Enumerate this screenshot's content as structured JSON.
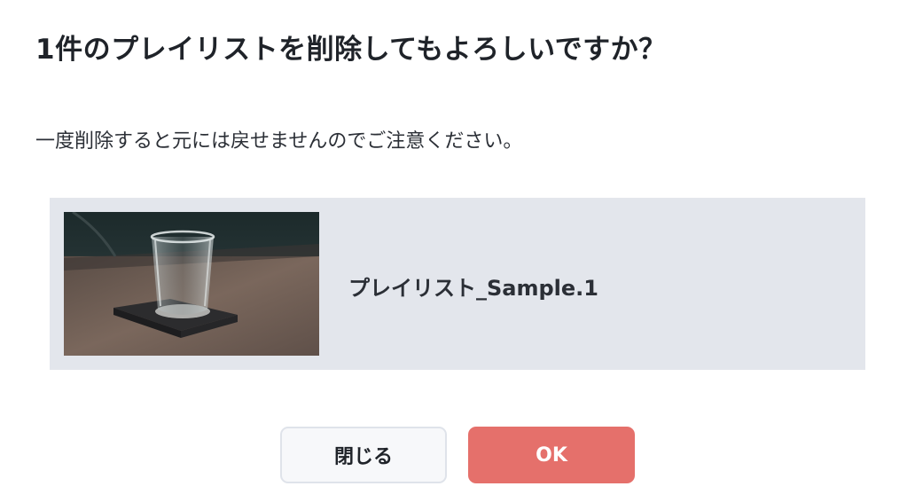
{
  "dialog": {
    "title": "1件のプレイリストを削除してもよろしいですか？",
    "message": "一度削除すると元には戻せませんのでご注意ください。"
  },
  "playlist": {
    "name": "プレイリスト_Sample.1",
    "thumbnail": "glass-on-coaster-photo"
  },
  "buttons": {
    "close_label": "閉じる",
    "ok_label": "OK"
  },
  "colors": {
    "ok_button": "#e5706b",
    "card_background": "#e3e6ec",
    "close_button": "#f7f8fa"
  }
}
